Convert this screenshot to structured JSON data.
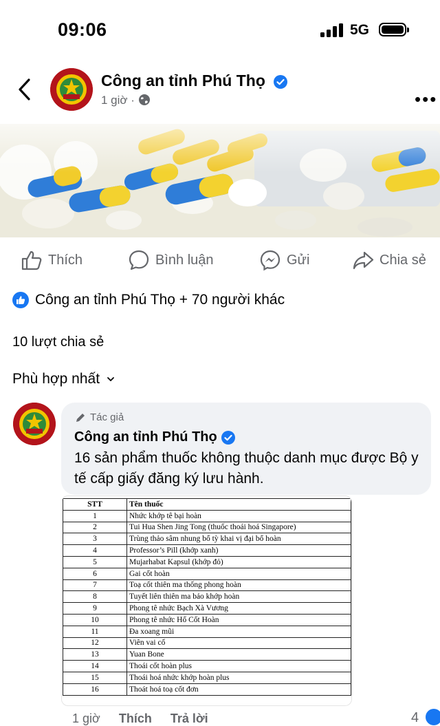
{
  "status_bar": {
    "time": "09:06",
    "network": "5G"
  },
  "header": {
    "page_name": "Công an tỉnh Phú Thọ",
    "time_ago": "1 giờ",
    "separator": "·"
  },
  "actions": {
    "like": "Thích",
    "comment": "Bình luận",
    "send": "Gửi",
    "share": "Chia sẻ"
  },
  "reactions": {
    "text": "Công an tỉnh Phú Thọ + 70 người khác"
  },
  "shares": "10 lượt chia sẻ",
  "sort": "Phù hợp nhất",
  "comment": {
    "author_tag": "Tác giả",
    "name": "Công an tỉnh Phú Thọ",
    "text": "16 sản phẩm thuốc không thuộc danh mục được Bộ y tế cấp giấy đăng ký lưu hành."
  },
  "drug_table": {
    "headers": [
      "STT",
      "Tên thuốc"
    ],
    "rows": [
      [
        "1",
        "Nhức khớp tê bại hoàn"
      ],
      [
        "2",
        "Tui Hua Shen Jing Tong (thuốc thoái hoá Singapore)"
      ],
      [
        "3",
        "Trùng thảo sâm nhung bổ tỳ khai vị đại bổ hoàn"
      ],
      [
        "4",
        "Professor’s Pill (khớp xanh)"
      ],
      [
        "5",
        "Mujarhabat Kapsul (khớp đỏ)"
      ],
      [
        "6",
        "Gai cốt hoàn"
      ],
      [
        "7",
        "Toạ cốt thiên ma thống phong hoàn"
      ],
      [
        "8",
        "Tuyết liên thiên ma bảo khớp hoàn"
      ],
      [
        "9",
        "Phong tê nhức Bạch Xà Vương"
      ],
      [
        "10",
        "Phong tê nhức Hổ Cốt Hoàn"
      ],
      [
        "11",
        "Đa xoang mũi"
      ],
      [
        "12",
        "Viên vai cổ"
      ],
      [
        "13",
        "Yuan Bone"
      ],
      [
        "14",
        "Thoái cốt hoàn plus"
      ],
      [
        "15",
        "Thoái hoá nhức khớp hoàn plus"
      ],
      [
        "16",
        "Thoát hoá toạ cốt đơn"
      ]
    ]
  },
  "comment_footer": {
    "time_ago": "1 giờ",
    "like": "Thích",
    "reply": "Trả lời",
    "like_count": "4"
  },
  "colors": {
    "brand_blue": "#1877f2",
    "muted_text": "#65676b",
    "bubble_bg": "#f0f2f5",
    "avatar_red": "#b3141b"
  }
}
